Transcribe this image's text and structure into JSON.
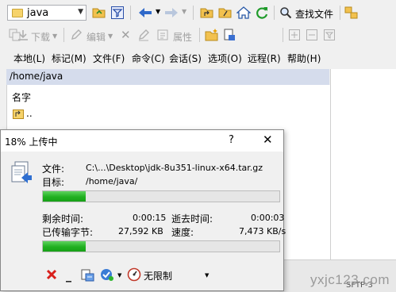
{
  "path_combo": {
    "value": "java"
  },
  "toolbar": {
    "find_file_label": "查找文件",
    "download_label": "下载",
    "edit_label": "编辑",
    "properties_label": "属性"
  },
  "menu": [
    "本地(L)",
    "标记(M)",
    "文件(F)",
    "命令(C)",
    "会话(S)",
    "选项(O)",
    "远程(R)",
    "帮助(H)"
  ],
  "file_panel": {
    "path": "/home/java",
    "column_name": "名字",
    "parent_dir": ".."
  },
  "dialog": {
    "title": "18% 上传中",
    "help": "?",
    "file_label": "文件:",
    "file_value": "C:\\...\\Desktop\\jdk-8u351-linux-x64.tar.gz",
    "target_label": "目标:",
    "target_value": "/home/java/",
    "file_progress": 0.18,
    "remaining_label": "剩余时间:",
    "remaining_value": "0:00:15",
    "elapsed_label": "逝去时间:",
    "elapsed_value": "0:00:03",
    "transferred_label": "已传输字节:",
    "transferred_value": "27,592 KB",
    "speed_label": "速度:",
    "speed_value": "7,473 KB/s",
    "total_progress": 0.18,
    "speed_limit": "无限制"
  },
  "status_bar": {
    "partial": "SFTP-3"
  },
  "watermark": "yxjc123.com",
  "colors": {
    "progress_green": "#20b020",
    "path_bar": "#d5dcec",
    "cancel_red": "#d9201c"
  }
}
